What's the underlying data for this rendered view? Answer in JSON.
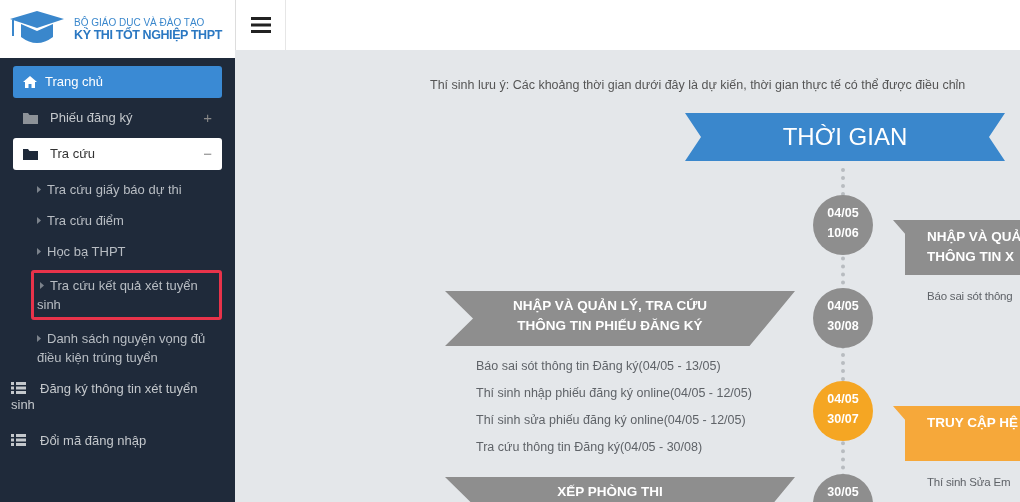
{
  "logo": {
    "line_1": "BỘ GIÁO DỤC VÀ ĐÀO TẠO",
    "line_2": "KỲ THI TỐT NGHIỆP THPT"
  },
  "sidebar": {
    "items": [
      {
        "label": "Trang chủ",
        "kind": "home",
        "selected": true
      },
      {
        "label": "Phiếu đăng ký",
        "kind": "folder",
        "selected": false,
        "expanded": false,
        "toggle": "+"
      },
      {
        "label": "Tra cứu",
        "kind": "folder",
        "selected": false,
        "expanded": true,
        "toggle": "−",
        "children": [
          {
            "label": "Tra cứu giấy báo dự thi",
            "highlighted": false
          },
          {
            "label": "Tra cứu điểm",
            "highlighted": false
          },
          {
            "label": "Học bạ THPT",
            "highlighted": false
          },
          {
            "label": "Tra cứu kết quả xét tuyển sinh",
            "highlighted": true
          },
          {
            "label": "Danh sách nguyện vọng đủ điều kiện trúng tuyển",
            "highlighted": false
          }
        ]
      },
      {
        "label": "Đăng ký thông tin xét tuyển sinh",
        "kind": "list",
        "selected": false
      },
      {
        "label": "Đổi mã đăng nhập",
        "kind": "list",
        "selected": false
      }
    ]
  },
  "notice": "Thí sinh lưu ý: Các khoảng thời gian dưới đây là dự kiến, thời gian thực tế có thể được điều chỉn",
  "timeline": {
    "title": "THỜI GIAN",
    "events": [
      {
        "date_from": "04/05",
        "date_to": "10/06",
        "highlighted": false,
        "kind": "right",
        "title_lines": [
          "NHẬP VÀ QUẢ",
          "THÔNG TIN X"
        ],
        "items": [
          "Báo sai sót thông"
        ]
      },
      {
        "date_from": "04/05",
        "date_to": "30/08",
        "highlighted": false,
        "kind": "left",
        "title_lines": [
          "NHẬP VÀ QUẢN LÝ, TRA CỨU",
          "THÔNG TIN PHIẾU ĐĂNG KÝ"
        ],
        "items": [
          "Báo sai sót thông tin Đăng ký(04/05 - 13/05)",
          "Thí sinh nhập phiếu đăng ký online(04/05 - 12/05)",
          "Thí sinh sửa phiếu đăng ký online(04/05 - 12/05)",
          "Tra cứu thông tin Đăng ký(04/05 - 30/08)"
        ]
      },
      {
        "date_from": "04/05",
        "date_to": "30/07",
        "highlighted": true,
        "kind": "right",
        "title_lines": [
          "TRUY CẬP HỆ"
        ],
        "items": [
          "Thí sinh Sửa Em"
        ]
      },
      {
        "date_from": "30/05",
        "highlighted": false,
        "kind": "left",
        "title_lines": [
          "XẾP PHÒNG THI"
        ]
      }
    ]
  }
}
